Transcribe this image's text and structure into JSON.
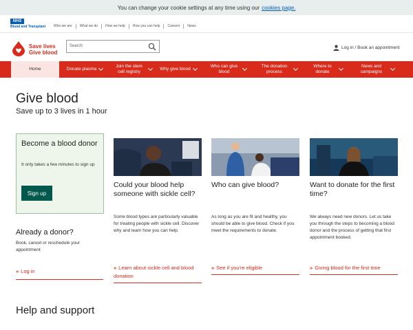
{
  "cookie": {
    "text": "You can change your cookie settings at any time using our",
    "link": "cookies page."
  },
  "org": {
    "logo_text": "NHS",
    "name": "Blood and Transplant"
  },
  "top_links": [
    "Who we are",
    "What we do",
    "How we help",
    "How you can help",
    "Careers",
    "News"
  ],
  "brand": {
    "line1": "Save lives",
    "line2": "Give blood"
  },
  "search": {
    "placeholder": "Search"
  },
  "account": {
    "label": "Log in / Book an appointment"
  },
  "nav": [
    {
      "label": "Home"
    },
    {
      "label": "Donate plasma"
    },
    {
      "label": "Join the stem cell registry"
    },
    {
      "label": "Why give blood"
    },
    {
      "label": "Who can give blood"
    },
    {
      "label": "The donation process"
    },
    {
      "label": "Where to donate"
    },
    {
      "label": "News and campaigns"
    }
  ],
  "hero": {
    "title": "Give blood",
    "subtitle": "Save up to 3 lives in 1 hour"
  },
  "become": {
    "title": "Become a blood donor",
    "text": "It only takes a few minutes to sign up",
    "button": "Sign up"
  },
  "already": {
    "title": "Already a donor?",
    "text": "Book, cancel or reschedule your appointment",
    "link": "Log in"
  },
  "cards": [
    {
      "title": "Could your blood help someone with sickle cell?",
      "text": "Some blood types are particularly valuable for treating people with sickle cell. Discover why and learn how you can help.",
      "link": "Learn about sickle cell and blood donation"
    },
    {
      "title": "Who can give blood?",
      "text": "As long as you are fit and healthy, you should be able to give blood. Check if you meet the requirements to donate.",
      "link": "See if you're eligible"
    },
    {
      "title": "Want to donate for the first time?",
      "text": "We always need new donors. Let us take you through the steps to becoming a blood donor and the process of getting that first appointment booked.",
      "link": "Giving blood for the first time"
    }
  ],
  "help": {
    "title": "Help and support"
  },
  "colors": {
    "brand_red": "#d92b1c",
    "nhs_blue": "#005eb8",
    "button_green": "#00594c",
    "panel_green": "#eef6ec"
  },
  "icons": [
    "search-icon",
    "user-icon",
    "chevron-down-icon",
    "blood-drop-logo",
    "double-chevron-right-icon"
  ]
}
